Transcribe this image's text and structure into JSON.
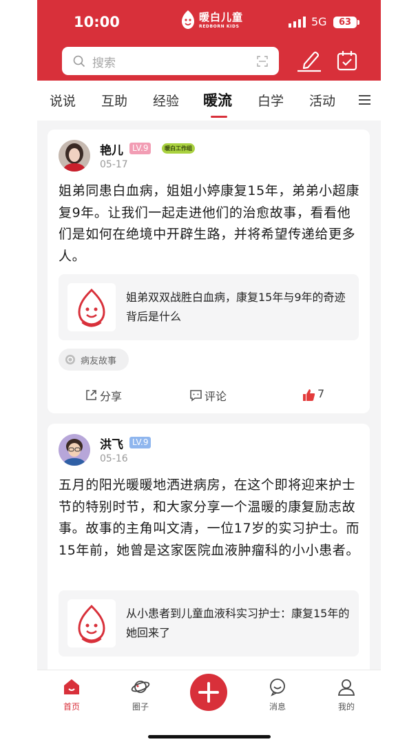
{
  "status_bar": {
    "time": "10:00",
    "network": "5G",
    "battery": "63"
  },
  "brand": {
    "name": "暖白儿童",
    "subtitle": "REDBORN KIDS"
  },
  "search": {
    "placeholder": "搜索"
  },
  "tabs": [
    {
      "label": "说说"
    },
    {
      "label": "互助"
    },
    {
      "label": "经验"
    },
    {
      "label": "暖流",
      "active": true
    },
    {
      "label": "白学"
    },
    {
      "label": "活动"
    }
  ],
  "posts": [
    {
      "author": "艳儿",
      "level": "LV.9",
      "badge": "暖白工作组",
      "date": "05-17",
      "text": "姐弟同患白血病，姐姐小婷康复15年，弟弟小超康复9年。让我们一起走进他们的治愈故事，看看他们是如何在绝境中开辟生路，并将希望传递给更多人。",
      "link_title": "姐弟双双战胜白血病，康复15年与9年的奇迹背后是什么",
      "topic": "病友故事",
      "share_label": "分享",
      "comment_label": "评论",
      "like_count": "7"
    },
    {
      "author": "洪飞",
      "level": "LV.9",
      "date": "05-16",
      "text": "五月的阳光暖暖地洒进病房，在这个即将迎来护士节的特别时节，和大家分享一个温暖的康复励志故事。故事的主角叫文清，一位17岁的实习护士。而15年前，她曾是这家医院血液肿瘤科的小小患者。",
      "link_title": "从小患者到儿童血液科实习护士：康复15年的她回来了"
    }
  ],
  "bottom_nav": [
    {
      "label": "首页",
      "active": true
    },
    {
      "label": "圈子"
    },
    {
      "label": "消息"
    },
    {
      "label": "我的"
    }
  ],
  "colors": {
    "brand_red": "#d8303a",
    "lv_pink": "#f29db4",
    "lv_blue": "#8fb6ee",
    "work_tag": "#a9d13f"
  }
}
